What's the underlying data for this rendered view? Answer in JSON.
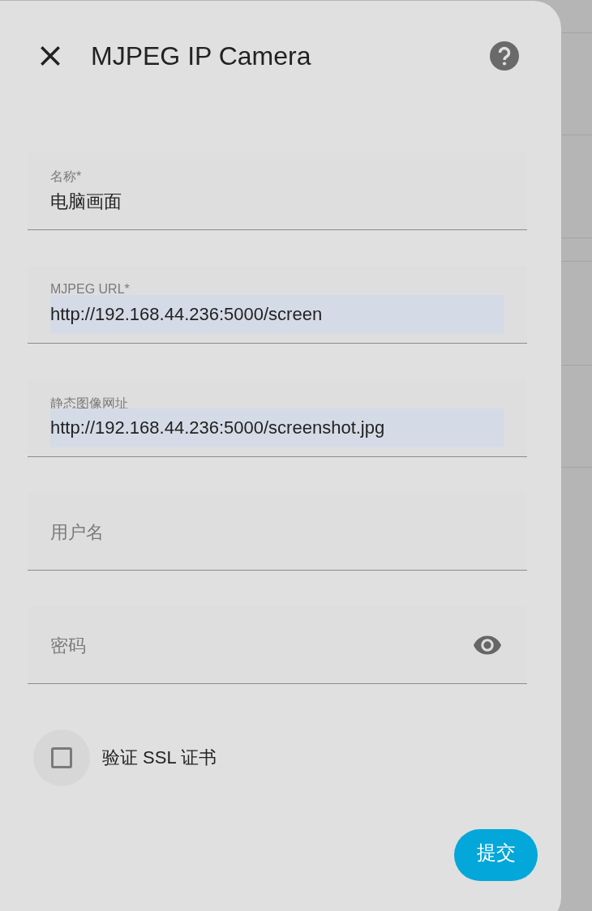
{
  "dialog": {
    "title": "MJPEG IP Camera"
  },
  "fields": [
    {
      "kind": "text",
      "label": "名称*",
      "value": "电脑画面",
      "autofilled": false
    },
    {
      "kind": "text",
      "label": "MJPEG URL*",
      "value": "http://192.168.44.236:5000/screen",
      "autofilled": true
    },
    {
      "kind": "text",
      "label": "静态图像网址",
      "value": "http://192.168.44.236:5000/screenshot.jpg",
      "autofilled": true
    },
    {
      "kind": "text",
      "label": "用户名",
      "autofilled": false
    },
    {
      "kind": "password",
      "label": "密码",
      "autofilled": false
    }
  ],
  "checkbox": {
    "label": "验证 SSL 证书",
    "checked": false
  },
  "submit": {
    "label": "提交"
  }
}
